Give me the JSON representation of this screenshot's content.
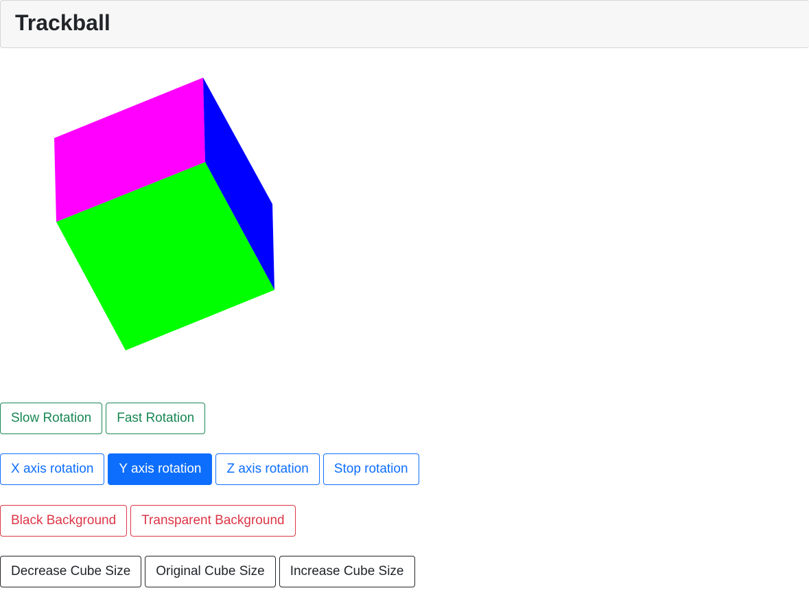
{
  "header": {
    "title": "Trackball"
  },
  "cube": {
    "faces": {
      "top": "#ff00ff",
      "front": "#00ff00",
      "side": "#0000ff"
    }
  },
  "speed_controls": {
    "slow": "Slow Rotation",
    "fast": "Fast Rotation",
    "color": "#198754"
  },
  "axis_controls": {
    "x": "X axis rotation",
    "y": "Y axis rotation",
    "z": "Z axis rotation",
    "stop": "Stop rotation",
    "active": "y",
    "color": "#0d6efd"
  },
  "background_controls": {
    "black": "Black Background",
    "transparent": "Transparent Background",
    "color": "#dc3545"
  },
  "size_controls": {
    "decrease": "Decrease Cube Size",
    "original": "Original Cube Size",
    "increase": "Increase Cube Size",
    "color": "#212529"
  }
}
